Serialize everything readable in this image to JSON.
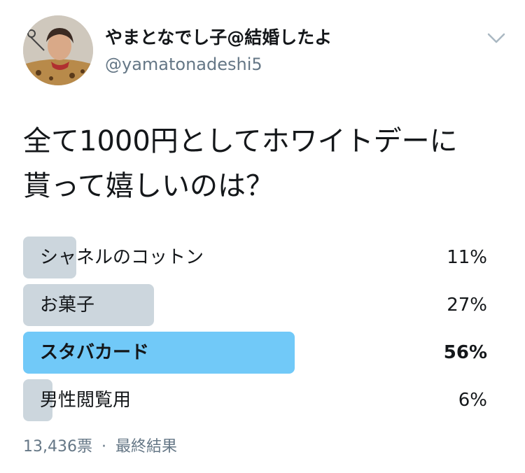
{
  "user": {
    "display_name": "やまとなでし子@結婚したよ",
    "handle": "@yamatonadeshi5",
    "avatar_icon": "profile-photo"
  },
  "menu_icon": "chevron-down-icon",
  "tweet": {
    "question_line1": "全て1000円としてホワイトデーに",
    "question_line2": "貰って嬉しいのは？"
  },
  "poll": {
    "options": [
      {
        "label": "シャネルのコットン",
        "percent_text": "11%",
        "percent": 11
      },
      {
        "label": "お菓子",
        "percent_text": "27%",
        "percent": 27
      },
      {
        "label": "スタバカード",
        "percent_text": "56%",
        "percent": 56
      },
      {
        "label": "男性閲覧用",
        "percent_text": "6%",
        "percent": 6
      }
    ],
    "winner_index": 2,
    "votes": "13,436票",
    "separator": "·",
    "status": "最終結果"
  },
  "colors": {
    "bar_default": "#ccd6dd",
    "bar_winner": "#71c9f8",
    "secondary_text": "#657786",
    "primary_text": "#14171a"
  }
}
